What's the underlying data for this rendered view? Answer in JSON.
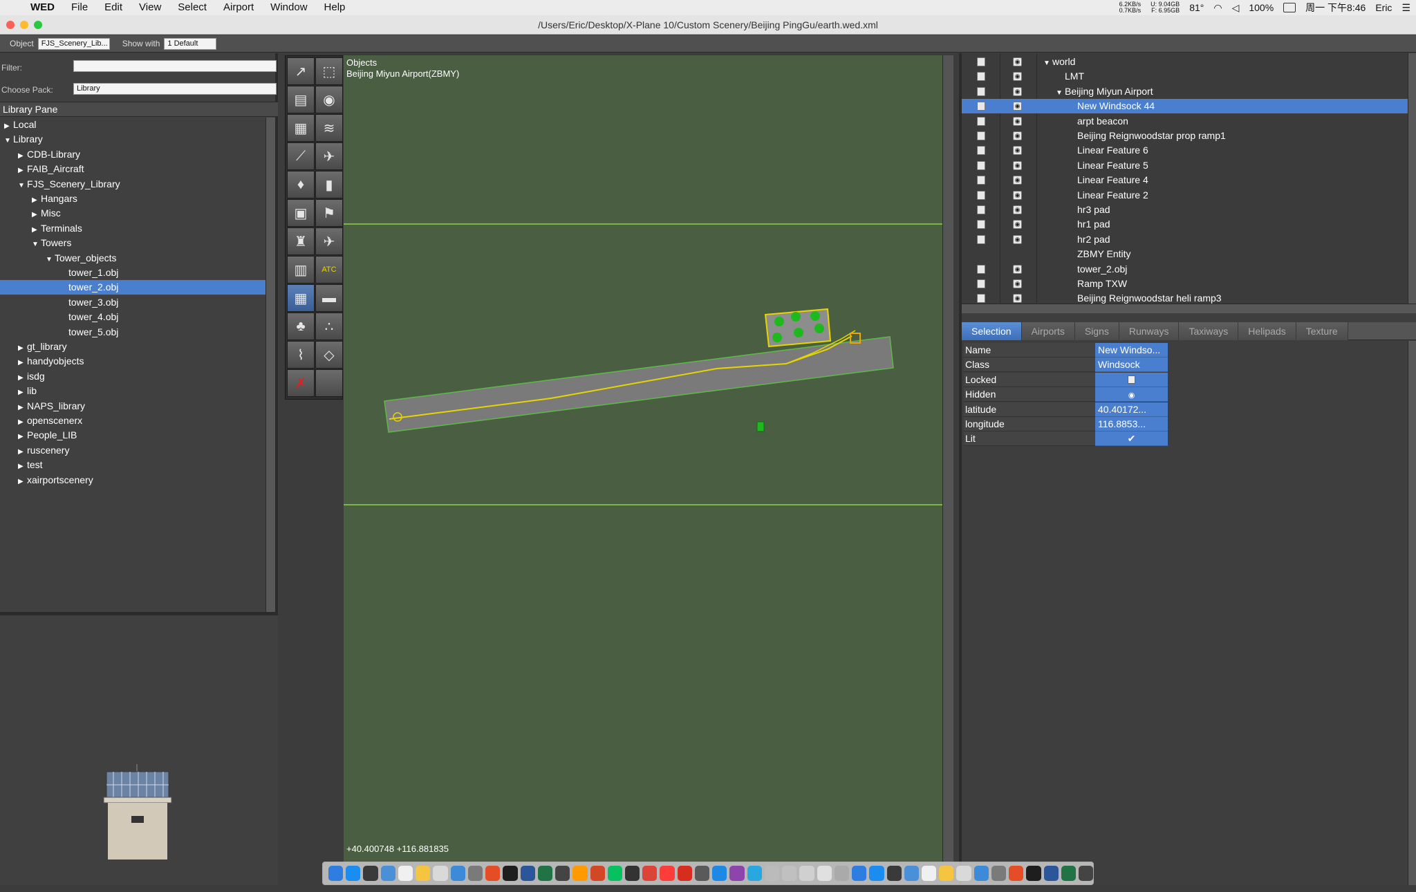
{
  "menubar": {
    "apple": "",
    "app_name": "WED",
    "menus": [
      "File",
      "Edit",
      "View",
      "Select",
      "Airport",
      "Window",
      "Help"
    ],
    "net_up": "6.2KB/s",
    "net_down": "0.7KB/s",
    "disk_u": "U: 9.04GB",
    "disk_f": "F: 6.95GB",
    "temp": "81°",
    "battery": "100%",
    "clock": "周一 下午8:46",
    "user": "Eric"
  },
  "window": {
    "title": "/Users/Eric/Desktop/X-Plane 10/Custom Scenery/Beijing PingGu/earth.wed.xml"
  },
  "toolbar": {
    "object_label": "Object",
    "object_value": "FJS_Scenery_Lib...",
    "show_with_label": "Show with",
    "show_with_value": "1 Default"
  },
  "library": {
    "filter_label": "Filter:",
    "filter_value": "",
    "pack_label": "Choose Pack:",
    "pack_value": "Library",
    "pane_title": "Library Pane",
    "items": [
      {
        "label": "Local",
        "indent": 0,
        "tri": "right"
      },
      {
        "label": "Library",
        "indent": 0,
        "tri": "down"
      },
      {
        "label": "CDB-Library",
        "indent": 1,
        "tri": "right"
      },
      {
        "label": "FAIB_Aircraft",
        "indent": 1,
        "tri": "right"
      },
      {
        "label": "FJS_Scenery_Library",
        "indent": 1,
        "tri": "down"
      },
      {
        "label": "Hangars",
        "indent": 2,
        "tri": "right"
      },
      {
        "label": "Misc",
        "indent": 2,
        "tri": "right"
      },
      {
        "label": "Terminals",
        "indent": 2,
        "tri": "right"
      },
      {
        "label": "Towers",
        "indent": 2,
        "tri": "down"
      },
      {
        "label": "Tower_objects",
        "indent": 3,
        "tri": "down"
      },
      {
        "label": "tower_1.obj",
        "indent": 4,
        "tri": "none"
      },
      {
        "label": "tower_2.obj",
        "indent": 4,
        "tri": "none",
        "selected": true
      },
      {
        "label": "tower_3.obj",
        "indent": 4,
        "tri": "none"
      },
      {
        "label": "tower_4.obj",
        "indent": 4,
        "tri": "none"
      },
      {
        "label": "tower_5.obj",
        "indent": 4,
        "tri": "none"
      },
      {
        "label": "gt_library",
        "indent": 1,
        "tri": "right"
      },
      {
        "label": "handyobjects",
        "indent": 1,
        "tri": "right"
      },
      {
        "label": "isdg",
        "indent": 1,
        "tri": "right"
      },
      {
        "label": "lib",
        "indent": 1,
        "tri": "right"
      },
      {
        "label": "NAPS_library",
        "indent": 1,
        "tri": "right"
      },
      {
        "label": "openscenerx",
        "indent": 1,
        "tri": "right"
      },
      {
        "label": "People_LIB",
        "indent": 1,
        "tri": "right"
      },
      {
        "label": "ruscenery",
        "indent": 1,
        "tri": "right"
      },
      {
        "label": "test",
        "indent": 1,
        "tri": "right"
      },
      {
        "label": "xairportscenery",
        "indent": 1,
        "tri": "right"
      }
    ]
  },
  "tools": [
    {
      "name": "vertex-tool",
      "glyph": "↗"
    },
    {
      "name": "marquee-tool",
      "glyph": "⬚"
    },
    {
      "name": "runway-tool",
      "glyph": "▤"
    },
    {
      "name": "helipad-tool",
      "glyph": "◉"
    },
    {
      "name": "taxiway-tool",
      "glyph": "▦"
    },
    {
      "name": "sealane-tool",
      "glyph": "≋"
    },
    {
      "name": "taxi-route-tool",
      "glyph": "⟋"
    },
    {
      "name": "ramp-start-tool",
      "glyph": "✈"
    },
    {
      "name": "light-tool",
      "glyph": "♦"
    },
    {
      "name": "sign-tool",
      "glyph": "▮"
    },
    {
      "name": "airport-tool",
      "glyph": "▣"
    },
    {
      "name": "windsock-tool",
      "glyph": "⚑"
    },
    {
      "name": "tower-viewpoint-tool",
      "glyph": "♜"
    },
    {
      "name": "aircraft-tool",
      "glyph": "✈"
    },
    {
      "name": "boundary-tool",
      "glyph": "▥"
    },
    {
      "name": "atc-tool",
      "glyph": "ATC"
    },
    {
      "name": "object-tool",
      "glyph": "▦",
      "selected": true
    },
    {
      "name": "facade-tool",
      "glyph": "▬"
    },
    {
      "name": "forest-tool",
      "glyph": "♣"
    },
    {
      "name": "string-tool",
      "glyph": "∴"
    },
    {
      "name": "line-tool",
      "glyph": "⌇"
    },
    {
      "name": "polygon-tool",
      "glyph": "◇"
    },
    {
      "name": "exclusion-tool",
      "glyph": "✗"
    },
    {
      "name": "empty-tool",
      "glyph": ""
    }
  ],
  "map": {
    "tool_name": "Objects",
    "airport": "Beijing Miyun Airport(ZBMY)",
    "coords": "+40.400748 +116.881835"
  },
  "hierarchy": {
    "items": [
      {
        "label": "world",
        "indent": 0,
        "tri": "down",
        "lock": true,
        "eye": true
      },
      {
        "label": "LMT",
        "indent": 1,
        "tri": "none",
        "lock": true,
        "eye": true
      },
      {
        "label": "Beijing Miyun Airport",
        "indent": 1,
        "tri": "down",
        "lock": true,
        "eye": true
      },
      {
        "label": "New Windsock 44",
        "indent": 2,
        "tri": "none",
        "lock": true,
        "eye": true,
        "selected": true
      },
      {
        "label": "arpt beacon",
        "indent": 2,
        "tri": "none",
        "lock": true,
        "eye": true
      },
      {
        "label": "Beijing Reignwoodstar prop ramp1",
        "indent": 2,
        "tri": "none",
        "lock": true,
        "eye": true
      },
      {
        "label": "Linear Feature 6",
        "indent": 2,
        "tri": "none",
        "lock": true,
        "eye": true
      },
      {
        "label": "Linear Feature 5",
        "indent": 2,
        "tri": "none",
        "lock": true,
        "eye": true
      },
      {
        "label": "Linear Feature 4",
        "indent": 2,
        "tri": "none",
        "lock": true,
        "eye": true
      },
      {
        "label": "Linear Feature 2",
        "indent": 2,
        "tri": "none",
        "lock": true,
        "eye": true
      },
      {
        "label": "hr3 pad",
        "indent": 2,
        "tri": "none",
        "lock": true,
        "eye": true
      },
      {
        "label": "hr1 pad",
        "indent": 2,
        "tri": "none",
        "lock": true,
        "eye": true
      },
      {
        "label": "hr2 pad",
        "indent": 2,
        "tri": "none",
        "lock": true,
        "eye": true
      },
      {
        "label": "ZBMY Entity",
        "indent": 2,
        "tri": "none",
        "lock": false,
        "eye": false
      },
      {
        "label": "tower_2.obj",
        "indent": 2,
        "tri": "none",
        "lock": true,
        "eye": true
      },
      {
        "label": "Ramp TXW",
        "indent": 2,
        "tri": "none",
        "lock": true,
        "eye": true
      },
      {
        "label": "Beijing Reignwoodstar heli ramp3",
        "indent": 2,
        "tri": "none",
        "lock": true,
        "eye": true
      }
    ]
  },
  "tabs": [
    {
      "label": "Selection",
      "selected": true
    },
    {
      "label": "Airports"
    },
    {
      "label": "Signs"
    },
    {
      "label": "Runways"
    },
    {
      "label": "Taxiways"
    },
    {
      "label": "Helipads"
    },
    {
      "label": "Texture"
    }
  ],
  "properties": [
    {
      "key": "Name",
      "value": "New Windso..."
    },
    {
      "key": "Class",
      "value": "Windsock"
    },
    {
      "key": "Locked",
      "value": "",
      "icon": "lock-icon"
    },
    {
      "key": "Hidden",
      "value": "",
      "icon": "eye-icon"
    },
    {
      "key": "latitude",
      "value": "40.40172..."
    },
    {
      "key": "longitude",
      "value": "116.8853..."
    },
    {
      "key": "Lit",
      "value": "✔"
    }
  ],
  "dock_count": 44,
  "colors": {
    "selection": "#4a7fcf",
    "map_ground": "#4a5f42",
    "runway": "#7a7a7a",
    "taxi_line": "#e6d600"
  }
}
